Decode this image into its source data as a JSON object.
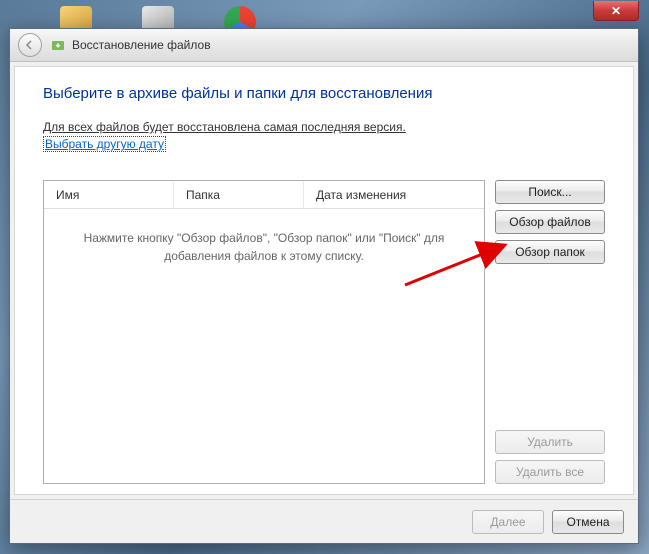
{
  "taskbar": {
    "icons": [
      "folder-icon",
      "app-icon",
      "chrome-icon"
    ]
  },
  "window": {
    "title": "Восстановление файлов",
    "close_label": "✕"
  },
  "content": {
    "heading": "Выберите в архиве файлы и папки для восстановления",
    "subtext": "Для всех файлов будет восстановлена самая последняя версия.",
    "link": "Выбрать другую дату"
  },
  "list": {
    "columns": {
      "name": "Имя",
      "folder": "Папка",
      "date": "Дата изменения"
    },
    "empty_hint": "Нажмите кнопку \"Обзор файлов\", \"Обзор папок\" или \"Поиск\" для добавления файлов к этому списку."
  },
  "buttons": {
    "search": "Поиск...",
    "browse_files": "Обзор файлов",
    "browse_folders": "Обзор папок",
    "delete": "Удалить",
    "delete_all": "Удалить все"
  },
  "footer": {
    "next": "Далее",
    "cancel": "Отмена"
  }
}
